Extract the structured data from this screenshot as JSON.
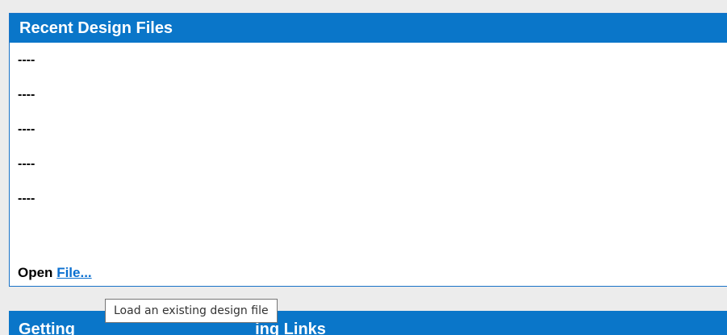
{
  "recent_panel": {
    "title": "Recent Design Files",
    "items": [
      "----",
      "----",
      "----",
      "----",
      "----"
    ],
    "open_label": "Open",
    "file_link": "File..."
  },
  "second_panel": {
    "title_left": "Getting",
    "title_right": "ing Links"
  },
  "tooltip": {
    "text": "Load an existing design file"
  },
  "colors": {
    "header_blue": "#0a76c9",
    "link_blue": "#0a6fd0",
    "page_bg": "#ececec"
  }
}
